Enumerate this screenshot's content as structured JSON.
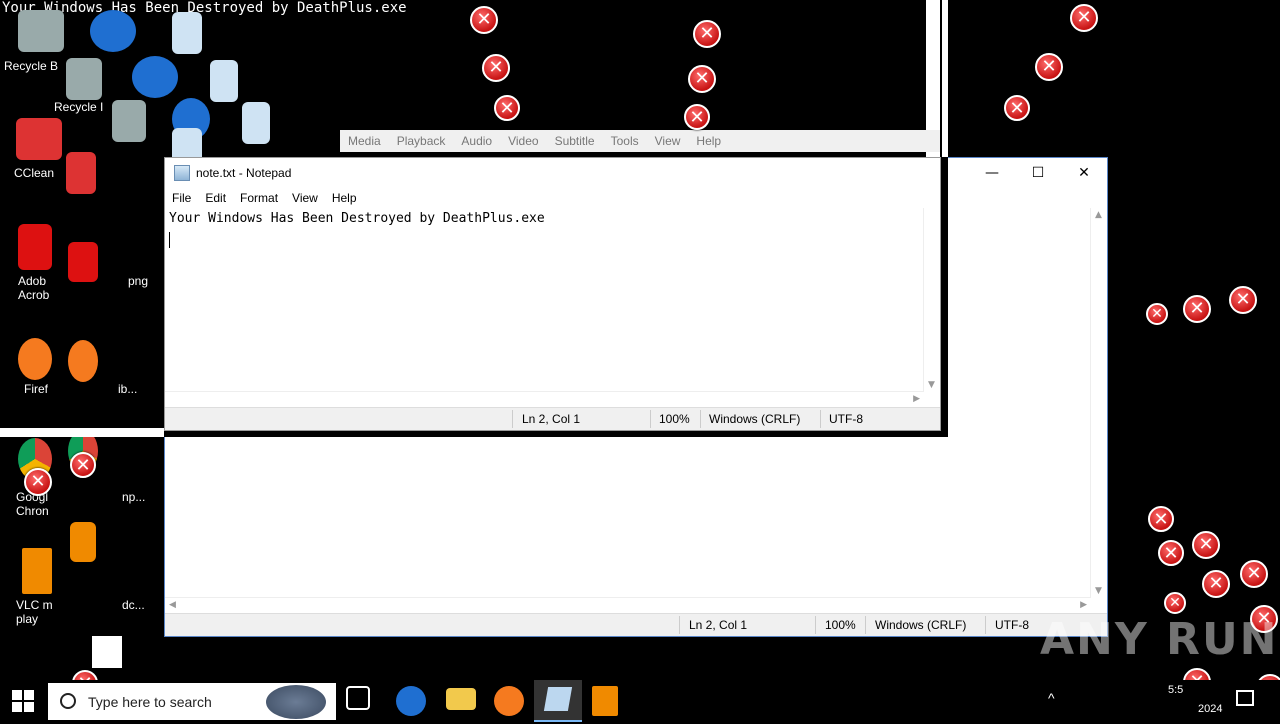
{
  "desktop": {
    "title_text": "Your Windows Has Been Destroyed by DeathPlus.exe",
    "labels": {
      "recycle1": "Recycle B",
      "recycle2": "Recycle I",
      "ccleaner": "CClean",
      "adobe": "Adob Acrob",
      "firefox": "Firef",
      "chrome": "Googl Chron",
      "vlc": "VLC m play",
      "png": "png",
      "ib": "ib...",
      "np": "np...",
      "dc": "dc..."
    }
  },
  "vlc": {
    "menu": [
      "Media",
      "Playback",
      "Audio",
      "Video",
      "Subtitle",
      "Tools",
      "View",
      "Help"
    ]
  },
  "notepad": {
    "title": "note.txt - Notepad",
    "menu": [
      "File",
      "Edit",
      "Format",
      "View",
      "Help"
    ],
    "content_line1": "Your Windows Has Been Destroyed by DeathPlus.exe",
    "status": {
      "position": "Ln 2, Col 1",
      "zoom": "100%",
      "line_ending": "Windows (CRLF)",
      "encoding": "UTF-8"
    },
    "window_buttons": {
      "minimize": "—",
      "maximize": "☐",
      "close": "✕"
    }
  },
  "taskbar": {
    "search_placeholder": "Type here to search",
    "clock_time": "5:5",
    "clock_date": "2024"
  },
  "watermark": "ANY RUN",
  "error_glyph": "✕"
}
